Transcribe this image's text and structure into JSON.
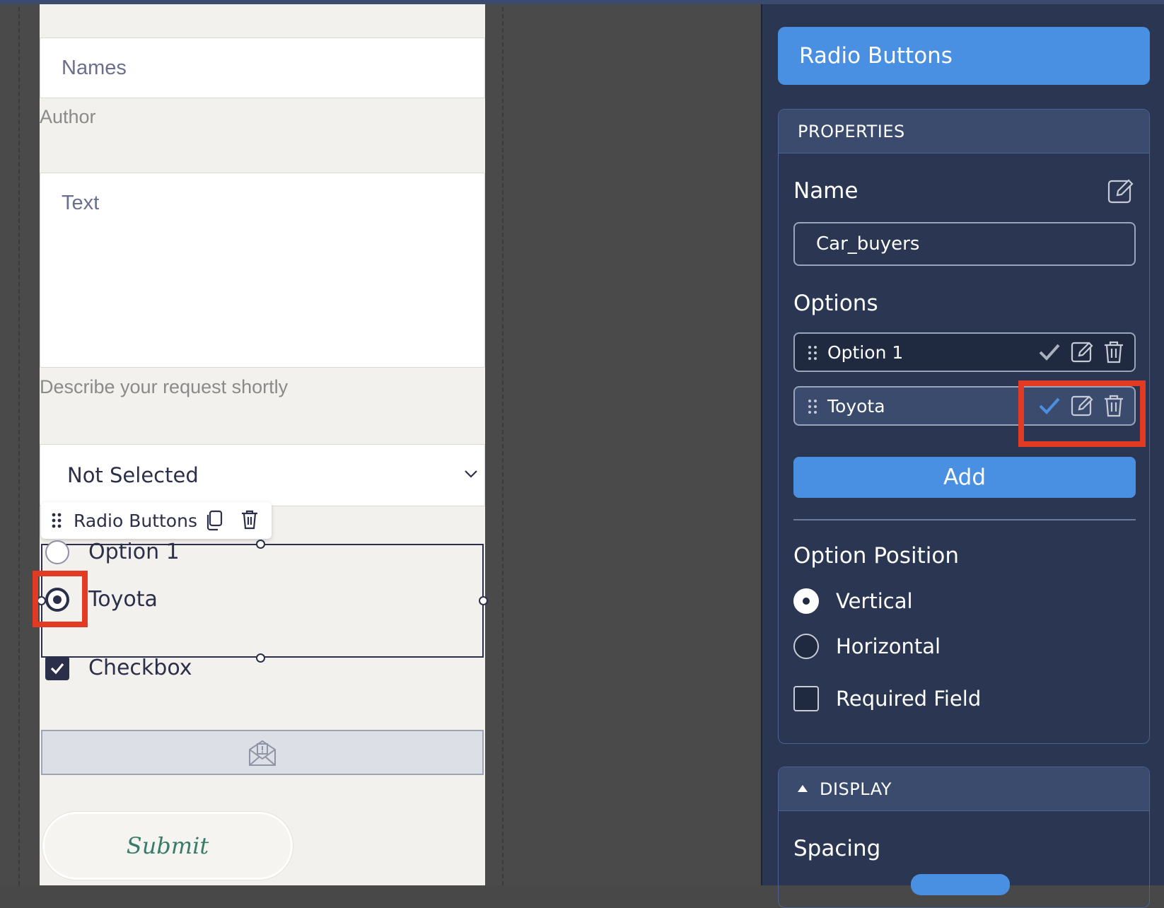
{
  "form": {
    "names_placeholder": "Names",
    "author_label": "Author",
    "text_placeholder": "Text",
    "text_helper": "Describe your request shortly",
    "select_value": "Not Selected",
    "toolbar_label": "Radio Buttons",
    "radio_options": [
      "Option 1",
      "Toyota"
    ],
    "checkbox_label": "Checkbox",
    "submit_label": "Submit"
  },
  "panel": {
    "title": "Radio Buttons",
    "properties_header": "PROPERTIES",
    "name_label": "Name",
    "name_value": "Car_buyers",
    "options_label": "Options",
    "options": [
      "Option 1",
      "Toyota"
    ],
    "add_label": "Add",
    "option_position_label": "Option Position",
    "position_vertical": "Vertical",
    "position_horizontal": "Horizontal",
    "required_label": "Required Field",
    "display_header": "DISPLAY",
    "spacing_label": "Spacing"
  },
  "colors": {
    "accent": "#4a90e2",
    "panel_bg": "#2b3752",
    "highlight": "#e33a23",
    "form_bg": "#f3f1ed"
  },
  "icons": [
    "drag-icon",
    "copy-icon",
    "trash-icon",
    "check-icon",
    "edit-icon",
    "chevron-down-icon",
    "email-icon",
    "triangle-up-icon"
  ]
}
